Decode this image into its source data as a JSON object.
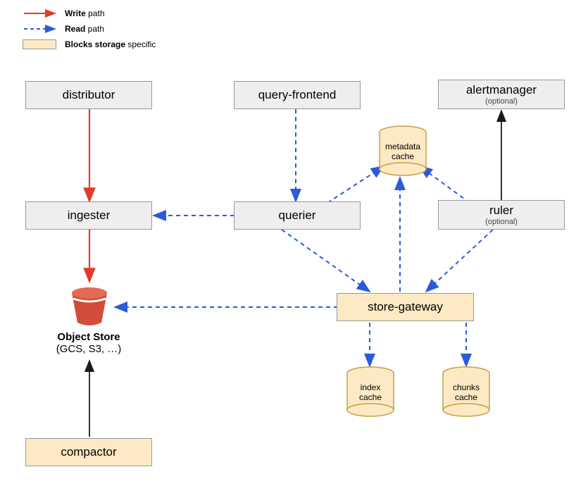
{
  "legend": {
    "write": {
      "bold": "Write",
      "rest": " path"
    },
    "read": {
      "bold": "Read",
      "rest": " path"
    },
    "blocks": {
      "bold": "Blocks storage",
      "rest": " specific"
    }
  },
  "nodes": {
    "distributor": {
      "label": "distributor"
    },
    "query_frontend": {
      "label": "query-frontend"
    },
    "alertmanager": {
      "label": "alertmanager",
      "sub": "(optional)"
    },
    "ingester": {
      "label": "ingester"
    },
    "querier": {
      "label": "querier"
    },
    "ruler": {
      "label": "ruler",
      "sub": "(optional)"
    },
    "store_gateway": {
      "label": "store-gateway"
    },
    "compactor": {
      "label": "compactor"
    },
    "object_store": {
      "title": "Object Store",
      "sub": "(GCS, S3, …)"
    }
  },
  "caches": {
    "metadata": {
      "line1": "metadata",
      "line2": "cache"
    },
    "index": {
      "line1": "index",
      "line2": "cache"
    },
    "chunks": {
      "line1": "chunks",
      "line2": "cache"
    }
  },
  "colors": {
    "write": "#e03c2d",
    "read": "#2b5bd9",
    "black": "#1a1a1a",
    "blocks_bg": "#fde9c4",
    "box_bg": "#eeeeee",
    "bucket": "#d34b3a"
  }
}
